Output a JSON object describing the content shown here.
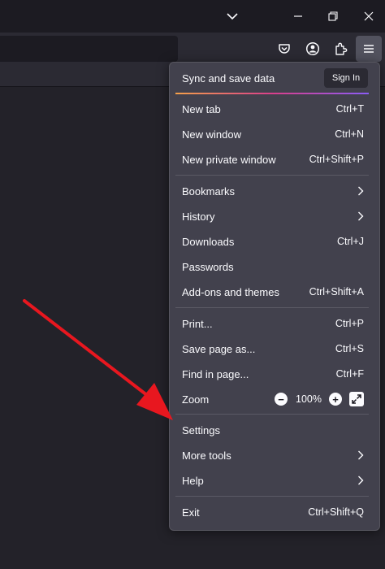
{
  "menu": {
    "sync": {
      "label": "Sync and save data",
      "button": "Sign In"
    },
    "sections": {
      "tabs": [
        {
          "label": "New tab",
          "shortcut": "Ctrl+T"
        },
        {
          "label": "New window",
          "shortcut": "Ctrl+N"
        },
        {
          "label": "New private window",
          "shortcut": "Ctrl+Shift+P"
        }
      ],
      "library": [
        {
          "label": "Bookmarks",
          "submenu": true
        },
        {
          "label": "History",
          "submenu": true
        },
        {
          "label": "Downloads",
          "shortcut": "Ctrl+J"
        },
        {
          "label": "Passwords"
        },
        {
          "label": "Add-ons and themes",
          "shortcut": "Ctrl+Shift+A"
        }
      ],
      "page": [
        {
          "label": "Print...",
          "shortcut": "Ctrl+P"
        },
        {
          "label": "Save page as...",
          "shortcut": "Ctrl+S"
        },
        {
          "label": "Find in page...",
          "shortcut": "Ctrl+F"
        }
      ],
      "zoom": {
        "label": "Zoom",
        "value": "100%",
        "minus": "−",
        "plus": "+"
      },
      "tools": [
        {
          "label": "Settings"
        },
        {
          "label": "More tools",
          "submenu": true
        },
        {
          "label": "Help",
          "submenu": true
        }
      ],
      "exit": {
        "label": "Exit",
        "shortcut": "Ctrl+Shift+Q"
      }
    }
  },
  "toolbar": {
    "icons": [
      "pocket-icon",
      "account-icon",
      "extensions-icon",
      "hamburger-menu-icon"
    ]
  },
  "titlebar": {
    "icons": [
      "list-all-tabs-icon",
      "minimize-icon",
      "restore-icon",
      "close-icon"
    ]
  },
  "colors": {
    "arrow": "#e8171f",
    "menu_bg": "#42414d",
    "accent_gradient": [
      "#f4a04a",
      "#d93f8b",
      "#8b5cf6"
    ]
  }
}
